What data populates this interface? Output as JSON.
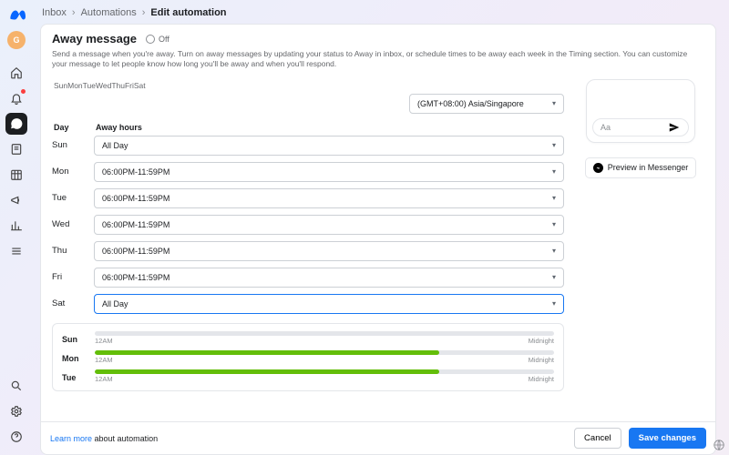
{
  "breadcrumb": {
    "a": "Inbox",
    "b": "Automations",
    "c": "Edit automation"
  },
  "avatar_initial": "G",
  "header": {
    "title": "Away message",
    "off_label": "Off",
    "desc": "Send a message when you're away. Turn on away messages by updating your status to Away in inbox, or schedule times to be away each week in the Timing section. You can customize your message to let people know how long you'll be away and when you'll respond."
  },
  "daystrip": "SunMonTueWedThuFriSat",
  "timezone": "(GMT+08:00) Asia/Singapore",
  "table": {
    "day": "Day",
    "hours": "Away hours"
  },
  "rows": [
    {
      "day": "Sun",
      "value": "All Day"
    },
    {
      "day": "Mon",
      "value": "06:00PM-11:59PM"
    },
    {
      "day": "Tue",
      "value": "06:00PM-11:59PM"
    },
    {
      "day": "Wed",
      "value": "06:00PM-11:59PM"
    },
    {
      "day": "Thu",
      "value": "06:00PM-11:59PM"
    },
    {
      "day": "Fri",
      "value": "06:00PM-11:59PM"
    },
    {
      "day": "Sat",
      "value": "All Day"
    }
  ],
  "timeline": {
    "rows": [
      {
        "label": "Sun",
        "start_pct": 0,
        "width_pct": 0
      },
      {
        "label": "Mon",
        "start_pct": 0,
        "width_pct": 75
      },
      {
        "label": "Tue",
        "start_pct": 0,
        "width_pct": 75
      }
    ],
    "left_label": "12AM",
    "right_label": "Midnight"
  },
  "preview": {
    "placeholder": "Aa",
    "button": "Preview in Messenger"
  },
  "footer": {
    "learn_link": "Learn more",
    "learn_text": " about automation",
    "cancel": "Cancel",
    "save": "Save changes"
  }
}
